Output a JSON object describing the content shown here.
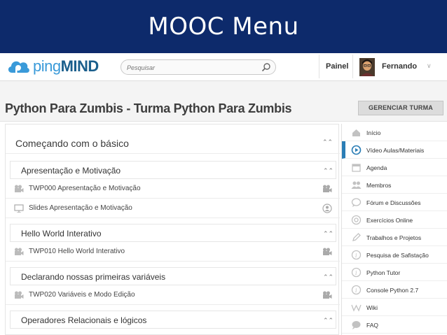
{
  "slide": {
    "title": "MOOC Menu"
  },
  "colors": {
    "banner": "#0d2a6b",
    "brand": "#3a9ad9",
    "active_accent": "#2a7db5"
  },
  "header": {
    "logo_text_light": "ping",
    "logo_text_bold": "MIND",
    "search_placeholder": "Pesquisar",
    "panel_label": "Painel",
    "user_name": "Fernando"
  },
  "course": {
    "title": "Python Para Zumbis - Turma Python Para Zumbis",
    "manage_label": "GERENCIAR TURMA"
  },
  "content": {
    "main_section": "Começando com o básico",
    "sections": [
      {
        "title": "Apresentação e Motivação",
        "items": [
          {
            "label": "TWP000 Apresentação e Motivação",
            "icon": "video-icon",
            "status_icon": "video-icon"
          },
          {
            "label": "Slides Apresentação e Motivação",
            "icon": "presentation-icon",
            "status_icon": "user-circle-icon"
          }
        ]
      },
      {
        "title": "Hello World Interativo",
        "items": [
          {
            "label": "TWP010 Hello World Interativo",
            "icon": "video-icon",
            "status_icon": "video-icon"
          }
        ]
      },
      {
        "title": "Declarando nossas primeiras variáveis",
        "items": [
          {
            "label": "TWP020 Variáveis e Modo Edição",
            "icon": "video-icon",
            "status_icon": "video-icon"
          }
        ]
      },
      {
        "title": "Operadores Relacionais e lógicos",
        "items": []
      }
    ]
  },
  "menu": {
    "items": [
      {
        "label": "Início",
        "icon": "home-icon"
      },
      {
        "label": "Vídeo Aulas/Materiais",
        "icon": "play-icon",
        "active": true
      },
      {
        "label": "Agenda",
        "icon": "calendar-icon"
      },
      {
        "label": "Membros",
        "icon": "members-icon"
      },
      {
        "label": "Fórum e Discussões",
        "icon": "chat-icon"
      },
      {
        "label": "Exercícios Online",
        "icon": "target-icon"
      },
      {
        "label": "Trabalhos e Projetos",
        "icon": "pencil-icon"
      },
      {
        "label": "Pesquisa de Safistação",
        "icon": "info-icon"
      },
      {
        "label": "Python Tutor",
        "icon": "info-icon"
      },
      {
        "label": "Console Python 2.7",
        "icon": "info-icon"
      },
      {
        "label": "Wiki",
        "icon": "wiki-icon"
      },
      {
        "label": "FAQ",
        "icon": "faq-icon"
      }
    ]
  }
}
